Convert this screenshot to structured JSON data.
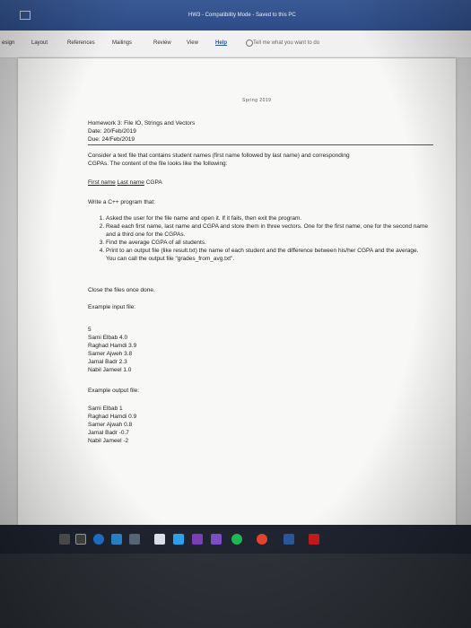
{
  "window": {
    "title": "HW3 - Compatibility Mode - Saved to this PC"
  },
  "ribbon": {
    "tabs": [
      "esign",
      "Layout",
      "References",
      "Mailings",
      "Review",
      "View",
      "Help"
    ],
    "active_tab": "Help",
    "tell_me": "Tell me what you want to do"
  },
  "page_header": "Spring 2019",
  "document": {
    "heading": "Homework 3: File IO, Strings and Vectors",
    "date": "Date: 20/Feb/2019",
    "due": "Due: 24/Feb/2019",
    "intro_1": "Consider a text file that contains student names (first name followed by last name) and corresponding",
    "intro_2": "CGPAs. The content of the file looks like the following:",
    "format_first": "First",
    "format_name1": "name",
    "format_last": "Last",
    "format_name2": "name",
    "format_cgpa": "CGPA",
    "task": "Write a C++ program that:",
    "steps": [
      "Asked the user for the file name and open it. If it fails, then exit the program.",
      "Read each first name, last name and CGPA and store them in three vectors. One for the first name, one for the second name and a third one for the CGPAs.",
      "Find the average CGPA of all students.",
      "Print to an output file (like result.txt) the name of each student and the difference between his/her CGPA and the average. You can call the output file \"grades_from_avg.txt\"."
    ],
    "close": "Close the files once done.",
    "example_input_label": "Example input file:",
    "example_input": [
      "5",
      "Sami Elbab 4.0",
      "Raghad Hamdi 3.9",
      "Samer Ajweh 3.8",
      "Jamal Badr 2.3",
      "Nabil Jameel 1.0"
    ],
    "example_output_label": "Example output file:",
    "example_output": [
      "Sami Elbab 1",
      "Raghad Hamdi 0.9",
      "Samer Ajwah 0.8",
      "Jamal Badr -0.7",
      "Nabil Jameel -2"
    ]
  },
  "taskbar": {
    "icons": [
      "task-view-icon",
      "edge-icon",
      "photos-icon",
      "store-icon",
      "mail-icon",
      "twitter-icon",
      "visual-studio-icon",
      "spotify-icon",
      "chrome-icon",
      "word-icon",
      "acrobat-icon"
    ]
  }
}
